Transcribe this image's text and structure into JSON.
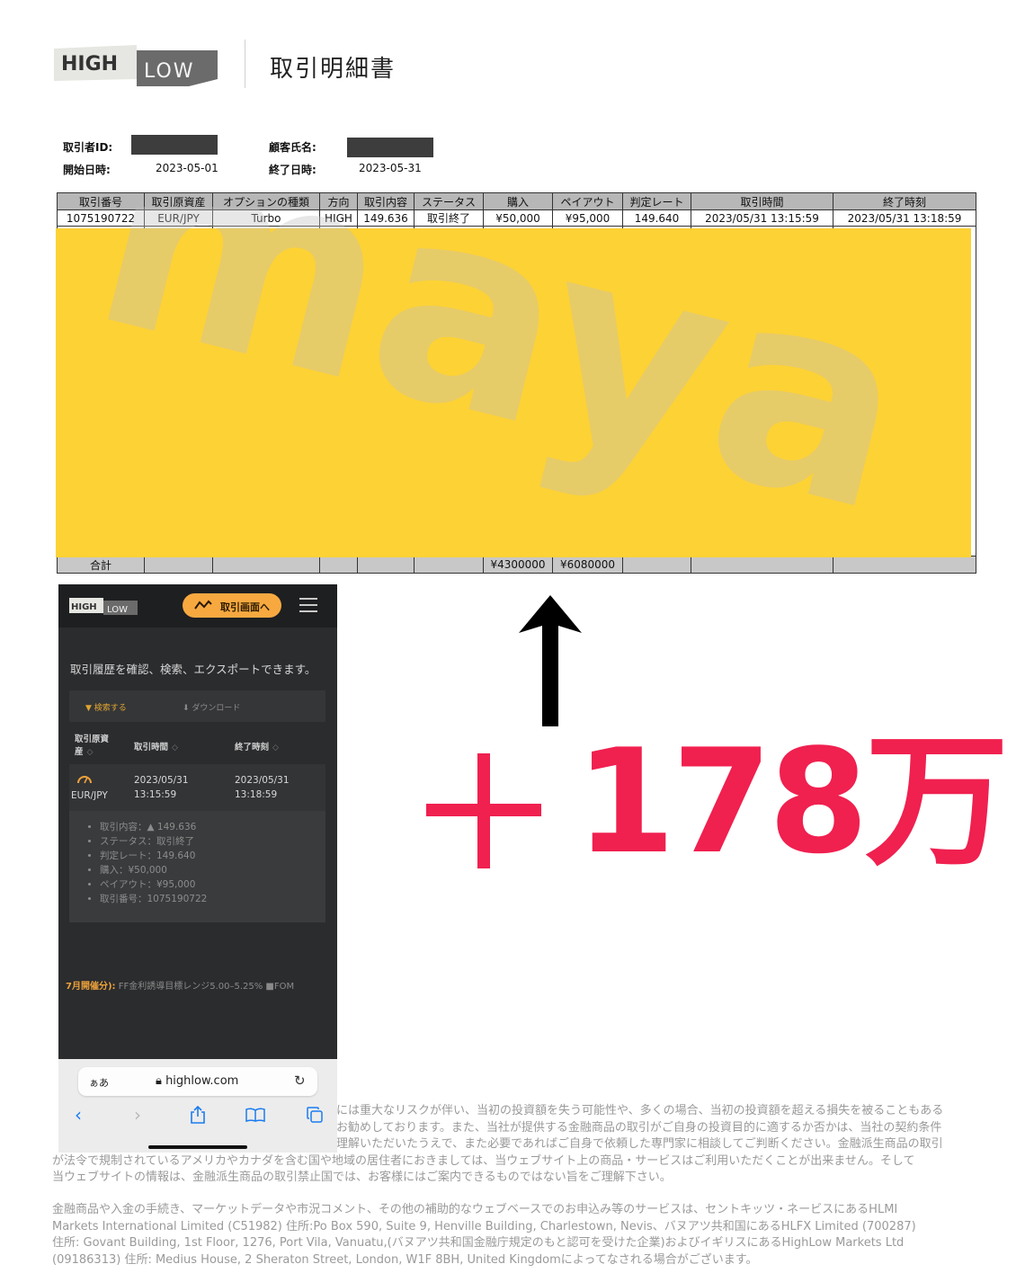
{
  "header": {
    "logo_high": "HIGH",
    "logo_low": "LOW",
    "title": "取引明細書"
  },
  "info": {
    "trader_id_label": "取引者ID:",
    "customer_name_label": "顧客氏名:",
    "start_label": "開始日時:",
    "start_value": "2023-05-01",
    "end_label": "終了日時:",
    "end_value": "2023-05-31"
  },
  "table": {
    "headers": [
      "取引番号",
      "取引原資産",
      "オプションの種類",
      "方向",
      "取引内容",
      "ステータス",
      "購入",
      "ペイアウト",
      "判定レート",
      "取引時間",
      "終了時刻"
    ],
    "row": [
      "1075190722",
      "EUR/JPY",
      "Turbo",
      "HIGH",
      "149.636",
      "取引終了",
      "¥50,000",
      "¥95,000",
      "149.640",
      "2023/05/31 13:15:59",
      "2023/05/31 13:18:59"
    ],
    "total_label": "合計",
    "total_purchase": "¥4300000",
    "total_payout": "¥6080000"
  },
  "watermark": "maya",
  "profit": {
    "amount_text": "178万"
  },
  "phone": {
    "logo_high": "HIGH",
    "logo_low": "LOW",
    "trade_button": "取引画面へ",
    "intro": "取引履歴を確認、検索、エクスポートできます。",
    "search_label": "検索する",
    "download_label": "ダウンロード",
    "col_asset_line1": "取引原資",
    "col_asset_line2": "産",
    "col_trade_time": "取引時間",
    "col_end_time": "終了時刻",
    "record_asset": "EUR/JPY",
    "record_trade_date": "2023/05/31",
    "record_trade_time": "13:15:59",
    "record_end_date": "2023/05/31",
    "record_end_time": "13:18:59",
    "details": [
      "取引内容：▲ 149.636",
      "ステータス：取引終了",
      "判定レート：149.640",
      "購入：¥50,000",
      "ペイアウト：¥95,000",
      "取引番号：1075190722"
    ],
    "ticker_highlight": "7月開催分):",
    "ticker_text": " FF金利誘導目標レンジ5.00–5.25%  ■FOM",
    "url_aa": "ぁあ",
    "url": "highlow.com"
  },
  "disclaimer": {
    "para1_line1": "には重大なリスクが伴い、当初の投資額を失う可能性や、多くの場合、当初の投資額を超える損失を被ることもある",
    "para1_line2": "お勧めしております。また、当社が提供する金融商品の取引がご自身の投資目的に適するか否かは、当社の契約条件",
    "para1_line3": "理解いただいたうえで、また必要であればご自身で依頼した専門家に相談してご判断ください。金融派生商品の取引",
    "para1_line4": "が法令で規制されているアメリカやカナダを含む国や地域の居住者におきましては、当ウェブサイト上の商品・サービスはご利用いただくことが出来ません。そして",
    "para1_line5": "当ウェブサイトの情報は、金融派生商品の取引禁止国では、お客様にはご案内できるものではない旨をご理解下さい。",
    "para2_line1": "金融商品や入金の手続き、マーケットデータや市況コメント、その他の補助的なウェブベースでのお申込み等のサービスは、セントキッツ・ネービスにあるHLMI",
    "para2_line2": "Markets International Limited (C51982) 住所:Po Box 590, Suite 9, Henville Building, Charlestown, Nevis、バヌアツ共和国にあるHLFX Limited (700287)",
    "para2_line3": "住所: Govant Building, 1st Floor, 1276, Port Vila, Vanuatu,(バヌアツ共和国金融庁規定のもと認可を受けた企業)およびイギリスにあるHighLow Markets Ltd",
    "para2_line4": "(09186313) 住所: Medius House, 2 Sheraton Street, London, W1F 8BH, United Kingdomによってなされる場合がございます。"
  },
  "colors": {
    "mask_yellow": "#fdd235",
    "profit_red": "#f0204f",
    "phone_bg": "#2b2c2e",
    "accent_orange": "#f7a940"
  }
}
